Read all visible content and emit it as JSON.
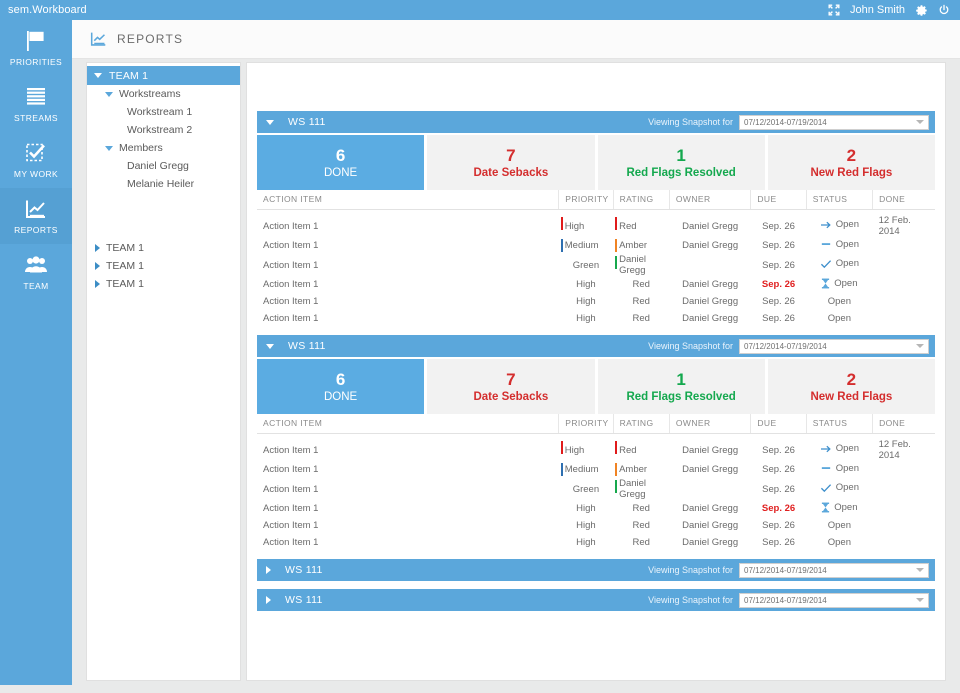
{
  "topbar": {
    "brand": "sem.Workboard",
    "user": "John Smith",
    "icons": {
      "fullscreen": "fullscreen-icon",
      "settings": "gear-icon",
      "power": "power-icon"
    }
  },
  "sidebar": {
    "items": [
      {
        "label": "PRIORITIES",
        "icon": "flag-icon",
        "active": false
      },
      {
        "label": "STREAMS",
        "icon": "stream-lines-icon",
        "active": false
      },
      {
        "label": "MY WORK",
        "icon": "checklist-icon",
        "active": false
      },
      {
        "label": "REPORTS",
        "icon": "chart-icon",
        "active": true
      },
      {
        "label": "TEAM",
        "icon": "people-icon",
        "active": false
      }
    ]
  },
  "page": {
    "title": "REPORTS",
    "icon": "chart-icon"
  },
  "tree": {
    "root": {
      "label": "TEAM 1",
      "expanded": true
    },
    "nodes": [
      {
        "label": "Workstreams",
        "level": 1,
        "expanded": true
      },
      {
        "label": "Workstream 1",
        "level": 2,
        "expanded": null
      },
      {
        "label": "Workstream 2",
        "level": 2,
        "expanded": null
      },
      {
        "label": "Members",
        "level": 1,
        "expanded": true
      },
      {
        "label": "Daniel Gregg",
        "level": 2,
        "expanded": null
      },
      {
        "label": "Melanie Heiler",
        "level": 2,
        "expanded": null
      }
    ],
    "collapsed_teams": [
      {
        "label": "TEAM 1"
      },
      {
        "label": "TEAM 1"
      },
      {
        "label": "TEAM 1"
      }
    ]
  },
  "labels": {
    "viewing_snapshot": "Viewing Snapshot for",
    "snapshot_range": "07/12/2014-07/19/2014"
  },
  "table_headers": [
    "ACTION ITEM",
    "PRIORITY",
    "RATING",
    "OWNER",
    "DUE",
    "STATUS",
    "DONE"
  ],
  "stats_template": [
    {
      "num": "6",
      "cap": "DONE",
      "style": "primary"
    },
    {
      "num": "7",
      "cap": "Date Sebacks",
      "style": "red"
    },
    {
      "num": "1",
      "cap": "Red Flags Resolved",
      "style": "green"
    },
    {
      "num": "2",
      "cap": "New Red Flags",
      "style": "red"
    }
  ],
  "rows_template": [
    {
      "action": "Action Item 1",
      "priority": "High",
      "pri_bar": "red",
      "rating": "Red",
      "rat_bar": "red",
      "owner": "Daniel Gregg",
      "due": "Sep. 26",
      "overdue": false,
      "status": "Open",
      "status_icon": "arrow-right-icon",
      "done": "12 Feb. 2014"
    },
    {
      "action": "Action Item 1",
      "priority": "Medium",
      "pri_bar": "blue",
      "rating": "Amber",
      "rat_bar": "orange",
      "owner": "Daniel Gregg",
      "due": "Sep. 26",
      "overdue": false,
      "status": "Open",
      "status_icon": "dash-icon",
      "done": ""
    },
    {
      "action": "Action Item 1",
      "priority": "Green",
      "pri_bar": "",
      "rating": "Daniel Gregg",
      "rat_bar": "green",
      "owner": "",
      "due": "Sep. 26",
      "overdue": false,
      "status": "Open",
      "status_icon": "check-icon",
      "done": ""
    },
    {
      "action": "Action Item 1",
      "priority": "High",
      "pri_bar": "",
      "rating": "Red",
      "rat_bar": "",
      "owner": "Daniel Gregg",
      "due": "Sep. 26",
      "overdue": true,
      "status": "Open",
      "status_icon": "hourglass-icon",
      "done": ""
    },
    {
      "action": "Action Item 1",
      "priority": "High",
      "pri_bar": "",
      "rating": "Red",
      "rat_bar": "",
      "owner": "Daniel Gregg",
      "due": "Sep. 26",
      "overdue": false,
      "status": "Open",
      "status_icon": "",
      "done": ""
    },
    {
      "action": "Action Item 1",
      "priority": "High",
      "pri_bar": "",
      "rating": "Red",
      "rat_bar": "",
      "owner": "Daniel Gregg",
      "due": "Sep. 26",
      "overdue": false,
      "status": "Open",
      "status_icon": "",
      "done": ""
    }
  ],
  "cards": [
    {
      "title": "WS 111",
      "expanded": true,
      "snapshot": "07/12/2014-07/19/2014"
    },
    {
      "title": "WS 111",
      "expanded": true,
      "snapshot": "07/12/2014-07/19/2014"
    },
    {
      "title": "WS 111",
      "expanded": false,
      "snapshot": "07/12/2014-07/19/2014"
    },
    {
      "title": "WS 111",
      "expanded": false,
      "snapshot": "07/12/2014-07/19/2014"
    }
  ],
  "colors": {
    "brand_blue": "#5ba7db",
    "tile_blue": "#5bace2",
    "red": "#d42e2e",
    "green": "#14a84e",
    "overdue_red": "#e02020",
    "amber": "#f08323"
  }
}
